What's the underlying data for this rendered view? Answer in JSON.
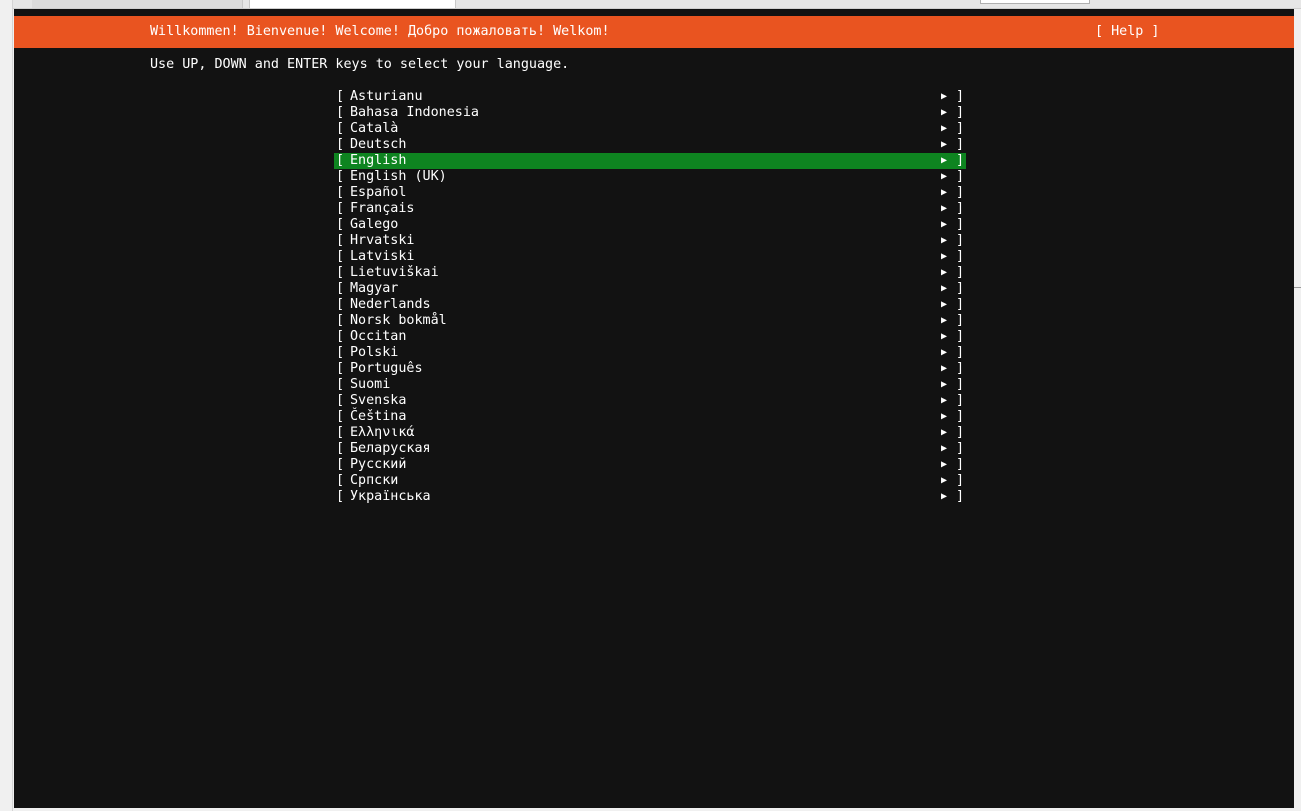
{
  "header": {
    "title": "Willkommen! Bienvenue! Welcome! Добро пожаловать! Welkom!",
    "help_label": "[ Help ]"
  },
  "instructions": "Use UP, DOWN and ENTER keys to select your language.",
  "list": {
    "bracket_open": "[",
    "bracket_close": "]",
    "arrow": "▶",
    "selected_index": 4,
    "items": [
      {
        "label": "Asturianu"
      },
      {
        "label": "Bahasa Indonesia"
      },
      {
        "label": "Català"
      },
      {
        "label": "Deutsch"
      },
      {
        "label": "English"
      },
      {
        "label": "English (UK)"
      },
      {
        "label": "Español"
      },
      {
        "label": "Français"
      },
      {
        "label": "Galego"
      },
      {
        "label": "Hrvatski"
      },
      {
        "label": "Latviski"
      },
      {
        "label": "Lietuviškai"
      },
      {
        "label": "Magyar"
      },
      {
        "label": "Nederlands"
      },
      {
        "label": "Norsk bokmål"
      },
      {
        "label": "Occitan"
      },
      {
        "label": "Polski"
      },
      {
        "label": "Português"
      },
      {
        "label": "Suomi"
      },
      {
        "label": "Svenska"
      },
      {
        "label": "Čeština"
      },
      {
        "label": "Ελληνικά"
      },
      {
        "label": "Беларуская"
      },
      {
        "label": "Русский"
      },
      {
        "label": "Српски"
      },
      {
        "label": "Українська"
      }
    ]
  },
  "colors": {
    "header_bg": "#e95420",
    "terminal_bg": "#121212",
    "selected_bg": "#0e8420",
    "text": "#ffffff"
  }
}
